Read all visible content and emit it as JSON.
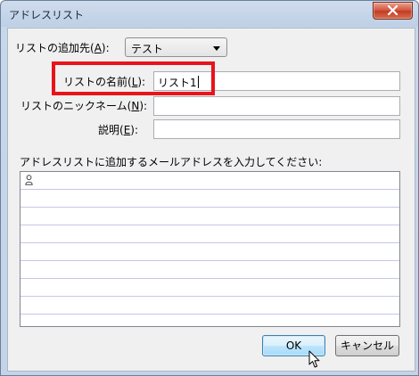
{
  "window": {
    "title": "アドレスリスト"
  },
  "form": {
    "add_to": {
      "label": "リストの追加先(",
      "mnemonic": "A",
      "suffix": "):",
      "value": "テスト"
    },
    "name": {
      "label": "リストの名前(",
      "mnemonic": "L",
      "suffix": "):",
      "value": "リスト1"
    },
    "nickname": {
      "label": "リストのニックネーム(",
      "mnemonic": "N",
      "suffix": "):",
      "value": ""
    },
    "description": {
      "label": "説明(",
      "mnemonic": "E",
      "suffix": "):",
      "value": ""
    }
  },
  "address_list": {
    "label": "アドレスリストに追加するメールアドレスを入力してください:",
    "entries": [
      "",
      "",
      "",
      "",
      "",
      "",
      "",
      "",
      ""
    ]
  },
  "buttons": {
    "ok": "OK",
    "cancel": "キャンセル"
  },
  "colors": {
    "highlight": "#e8141b",
    "list_line": "#c6c6e8",
    "ok_border": "#3c7fb1"
  },
  "icons": {
    "close": "close-icon",
    "person": "person-icon",
    "cursor": "mouse-pointer-icon"
  }
}
